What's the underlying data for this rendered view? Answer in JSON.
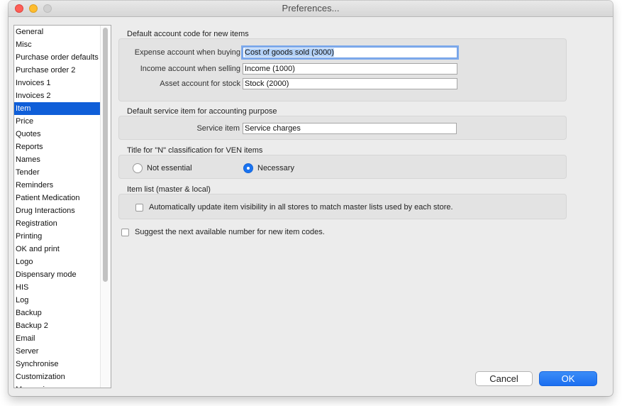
{
  "window": {
    "title": "Preferences..."
  },
  "sidebar": {
    "items": [
      {
        "label": "General"
      },
      {
        "label": "Misc"
      },
      {
        "label": "Purchase order defaults"
      },
      {
        "label": "Purchase order 2"
      },
      {
        "label": "Invoices 1"
      },
      {
        "label": "Invoices 2"
      },
      {
        "label": "Item",
        "selected": true
      },
      {
        "label": "Price"
      },
      {
        "label": "Quotes"
      },
      {
        "label": "Reports"
      },
      {
        "label": "Names"
      },
      {
        "label": "Tender"
      },
      {
        "label": "Reminders"
      },
      {
        "label": "Patient Medication"
      },
      {
        "label": "Drug Interactions"
      },
      {
        "label": "Registration"
      },
      {
        "label": "Printing"
      },
      {
        "label": "OK and print"
      },
      {
        "label": "Logo"
      },
      {
        "label": "Dispensary mode"
      },
      {
        "label": "HIS"
      },
      {
        "label": "Log"
      },
      {
        "label": "Backup"
      },
      {
        "label": "Backup 2"
      },
      {
        "label": "Email"
      },
      {
        "label": "Server"
      },
      {
        "label": "Synchronise"
      },
      {
        "label": "Customization"
      },
      {
        "label": "Messaging"
      }
    ]
  },
  "account_codes": {
    "heading": "Default account code for new items",
    "expense_label": "Expense account when buying",
    "expense_value": "Cost of goods sold (3000)",
    "income_label": "Income account when selling",
    "income_value": "Income (1000)",
    "asset_label": "Asset account for stock",
    "asset_value": "Stock (2000)"
  },
  "service_item": {
    "heading": "Default service item for accounting purpose",
    "label": "Service item",
    "value": "Service charges"
  },
  "ven": {
    "heading": "Title for \"N\" classification for VEN items",
    "options": [
      {
        "label": "Not essential",
        "selected": false
      },
      {
        "label": "Necessary",
        "selected": true
      }
    ]
  },
  "item_list": {
    "heading": "Item list (master & local)",
    "auto_update_label": "Automatically update item visibility in all stores to match master lists used by each store.",
    "auto_update_checked": false
  },
  "suggest_codes": {
    "label": "Suggest the next available number for new item codes.",
    "checked": false
  },
  "buttons": {
    "cancel": "Cancel",
    "ok": "OK"
  },
  "colors": {
    "selection": "#0f5ed8",
    "accent_button": "#1b6ff0",
    "close": "#fe5f57",
    "minimize": "#febc2e"
  }
}
